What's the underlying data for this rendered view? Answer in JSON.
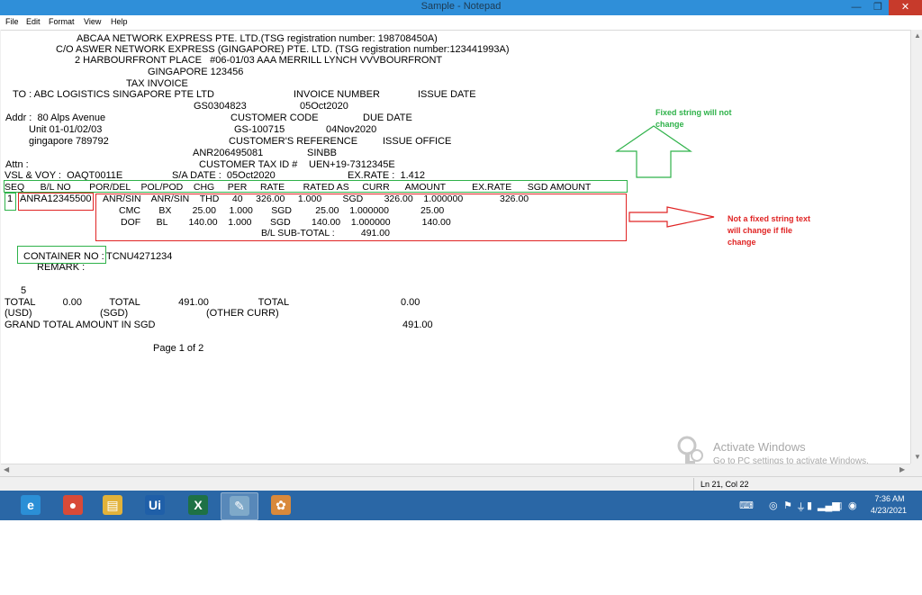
{
  "window": {
    "title": "Sample - Notepad",
    "caption_minimize": "—",
    "caption_maximize": "❐",
    "caption_close": "✕"
  },
  "menu": [
    "File",
    "Edit",
    "Format",
    "View",
    "Help"
  ],
  "document": {
    "lines": [
      "ABCAA NETWORK EXPRESS PTE. LTD.(TSG registration number: 198708450A)",
      "C/O ASWER NETWORK EXPRESS (GINGAPORE) PTE. LTD. (TSG registration number:123441993A)",
      "2 HARBOURFRONT PLACE   #06-01/03 AAA MERRILL LYNCH VVVBOURFRONT",
      "GINGAPORE 123456",
      "TAX INVOICE",
      "TO : ABC LOGISTICS SINGAPORE PTE LTD",
      "INVOICE NUMBER",
      "ISSUE DATE",
      "GS0304823",
      "05Oct2020",
      "Addr :  80 Alps Avenue",
      "CUSTOMER CODE",
      "DUE DATE",
      "Unit 01-01/02/03",
      "GS-100715",
      "04Nov2020",
      "gingapore 789792",
      "CUSTOMER'S REFERENCE",
      "ISSUE OFFICE",
      "ANR206495081",
      "SINBB",
      "Attn :",
      "CUSTOMER TAX ID #",
      "UEN+19-7312345E",
      "VSL & VOY :  OAQT0011E",
      "S/A DATE :  05Oct2020",
      "EX.RATE :  1.412",
      "SEQ      B/L NO       POR/DEL    POL/POD    CHG     PER     RATE       RATED AS     CURR      AMOUNT          EX.RATE      SGD AMOUNT",
      "1",
      "ANRA12345500",
      "ANR/SIN    ANR/SIN    THD     40     326.00     1.000        SGD        326.00    1.000000              326.00",
      "CMC       BX        25.00     1.000       SGD         25.00    1.000000            25.00",
      "DOF      BL        140.00    1.000       SGD        140.00    1.000000            140.00",
      "B/L SUB-TOTAL :          491.00",
      "CONTAINER NO :",
      "TCNU4271234",
      "REMARK :",
      "5",
      "TOTAL          0.00          TOTAL              491.00                  TOTAL",
      "0.00",
      "(USD)",
      "(SGD)",
      "(OTHER CURR)",
      "GRAND TOTAL AMOUNT IN SGD",
      "491.00",
      "Page 1 of 2"
    ]
  },
  "annotations": {
    "fixed_note": "Fixed string will not\nchange",
    "variable_note": "Not a fixed string text\nwill change if file\nchange",
    "green": "#2fb24a",
    "red": "#e02424"
  },
  "status": {
    "position": "Ln 21, Col 22"
  },
  "watermark": {
    "title": "Activate Windows",
    "subtitle": "Go to PC settings to activate Windows."
  },
  "taskbar": {
    "apps": [
      {
        "name": "internet-explorer",
        "glyph": "e",
        "color": "#2b8fd6"
      },
      {
        "name": "chrome",
        "glyph": "●",
        "color": "#d84a38"
      },
      {
        "name": "file-explorer",
        "glyph": "▤",
        "color": "#e2b23a"
      },
      {
        "name": "uipath",
        "glyph": "Ui",
        "color": "#1f5fa8"
      },
      {
        "name": "excel",
        "glyph": "X",
        "color": "#1e7145"
      },
      {
        "name": "notepad",
        "glyph": "✎",
        "color": "#7fa9c9"
      },
      {
        "name": "paint",
        "glyph": "✿",
        "color": "#d9893b"
      }
    ],
    "time": "7:36 AM",
    "date": "4/23/2021"
  }
}
